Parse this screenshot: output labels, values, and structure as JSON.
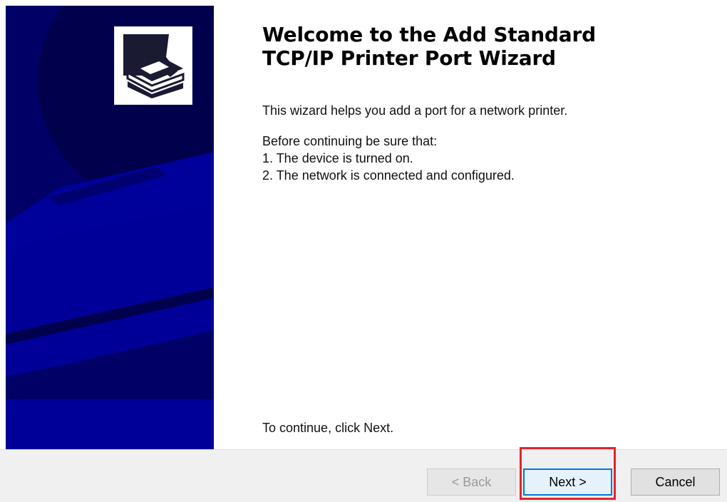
{
  "wizard": {
    "title_line1": "Welcome to the Add Standard",
    "title_line2": "TCP/IP Printer Port Wizard",
    "intro": "This wizard helps you add a port for a network printer.",
    "before_heading": "Before continuing be sure that:",
    "checklist": [
      "1.  The device is turned on.",
      "2.  The network is connected and configured."
    ],
    "continue_text": "To continue, click Next."
  },
  "banner": {
    "colors": {
      "background": "#000066",
      "printer": "#000099",
      "slot": "#00007a"
    },
    "logo_icon": "printer-wizard-icon"
  },
  "buttons": {
    "back": "< Back",
    "next": "Next >",
    "cancel": "Cancel"
  },
  "highlight": {
    "target": "next-button",
    "color": "#e0262d"
  }
}
